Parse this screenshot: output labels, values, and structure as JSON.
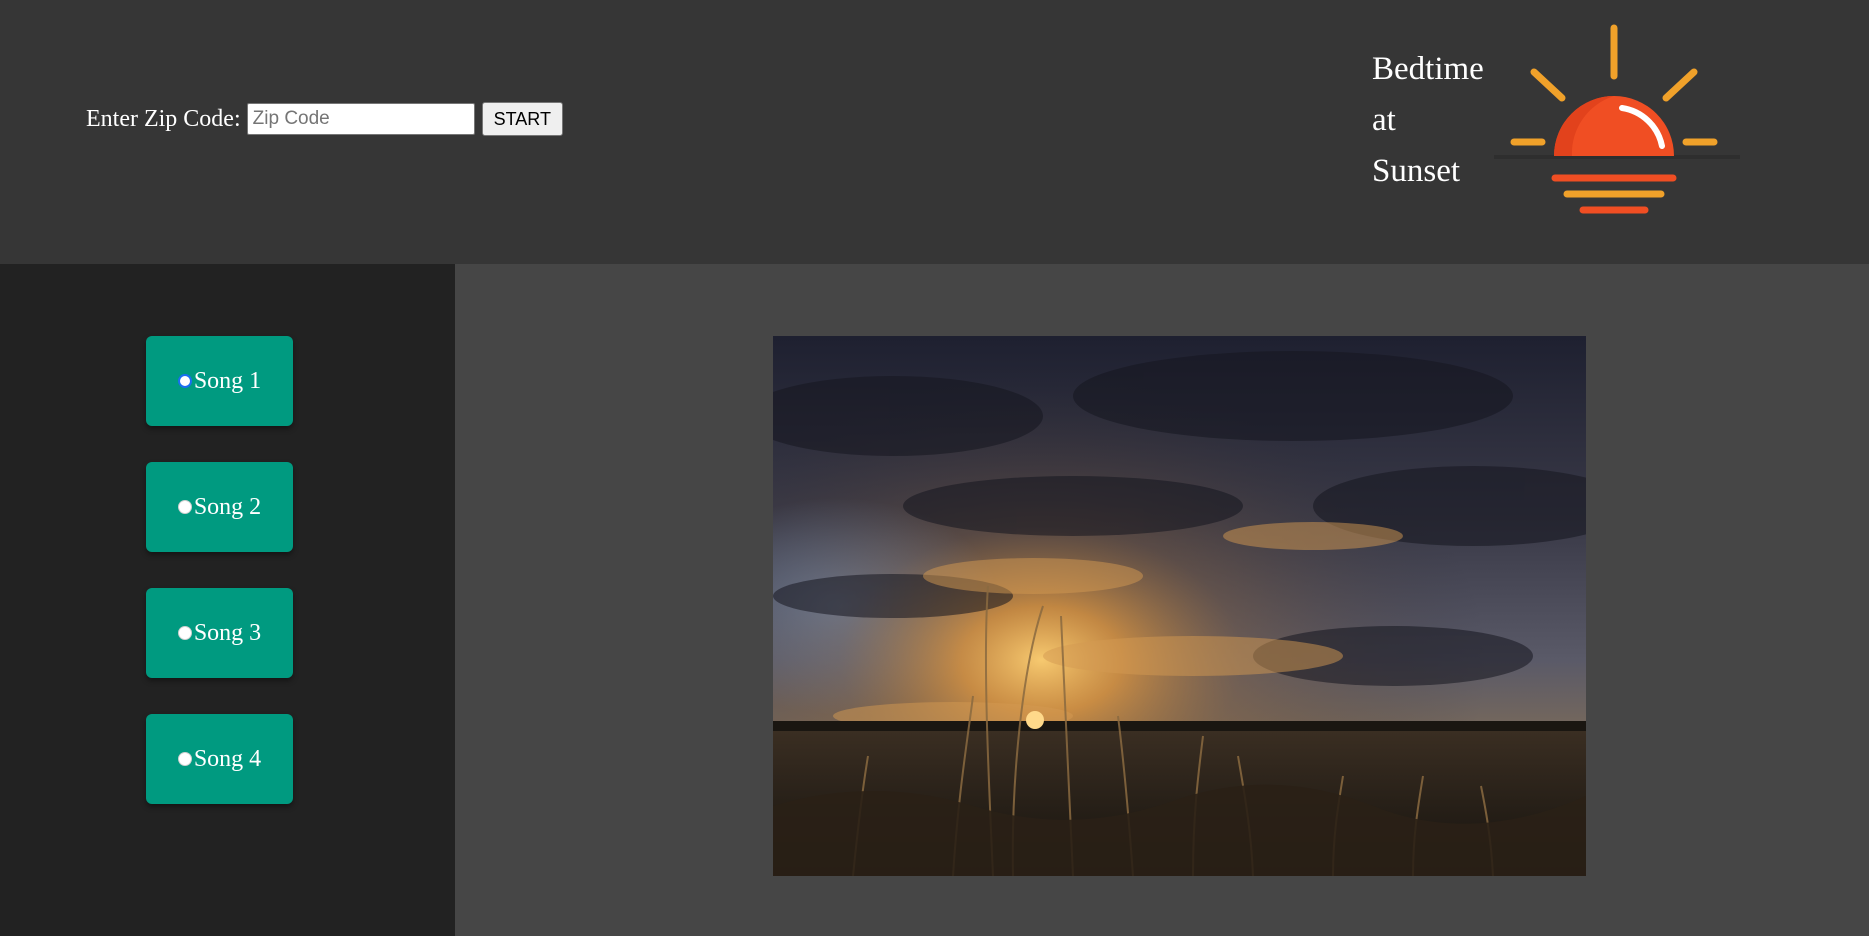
{
  "header": {
    "zip_label": "Enter Zip Code:",
    "zip_input_value": "",
    "zip_placeholder": "Zip Code",
    "start_label": "START",
    "title_lines": [
      "Bedtime",
      "at",
      "Sunset"
    ],
    "logo_icon": "sunset-icon"
  },
  "sidebar": {
    "songs": [
      {
        "label": "Song 1",
        "selected": true
      },
      {
        "label": "Song 2",
        "selected": false
      },
      {
        "label": "Song 3",
        "selected": false
      },
      {
        "label": "Song 4",
        "selected": false
      }
    ]
  },
  "main": {
    "image_subject": "sunset-over-field-image"
  },
  "colors": {
    "header_bg": "#363636",
    "sidebar_bg": "#222222",
    "main_bg": "#464646",
    "song_button": "#009a80",
    "sun_red": "#f04e23",
    "sun_orange": "#f0a12a"
  }
}
